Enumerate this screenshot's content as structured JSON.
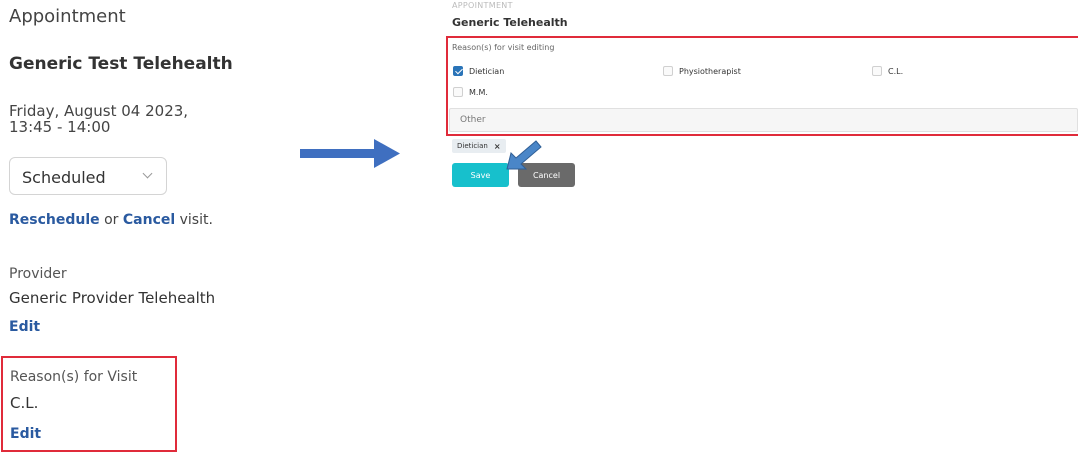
{
  "left": {
    "title": "Appointment",
    "patient_name": "Generic Test Telehealth",
    "date_line1": "Friday, August 04 2023,",
    "date_line2": "13:45 - 14:00",
    "status_select": {
      "value": "Scheduled"
    },
    "reschedule_link": "Reschedule",
    "or_text": " or ",
    "cancel_link": "Cancel",
    "visit_suffix": " visit.",
    "provider_label": "Provider",
    "provider_name": "Generic Provider Telehealth",
    "provider_edit": "Edit",
    "reason_label": "Reason(s) for Visit",
    "reason_value": "C.L.",
    "reason_edit": "Edit"
  },
  "right": {
    "section_label": "APPOINTMENT",
    "patient_name": "Generic Telehealth",
    "reason_editing_label": "Reason(s) for visit editing",
    "options": [
      {
        "label": "Dietician",
        "checked": true
      },
      {
        "label": "Physiotherapist",
        "checked": false
      },
      {
        "label": "C.L.",
        "checked": false
      },
      {
        "label": "M.M.",
        "checked": false
      }
    ],
    "other_placeholder": "Other",
    "selected_tag": "Dietician",
    "tag_remove": "×",
    "save_label": "Save",
    "cancel_label": "Cancel"
  },
  "colors": {
    "highlight_border": "#e02b3a",
    "link": "#2a5aa0",
    "save_button": "#17c0cc",
    "cancel_button": "#6a6a6a",
    "arrow": "#3f6fc0"
  },
  "icons": {
    "status_chevron": "chevron-down-icon",
    "transition_arrow": "arrow-right-icon",
    "pointer_arrow": "pointer-arrow-icon"
  }
}
